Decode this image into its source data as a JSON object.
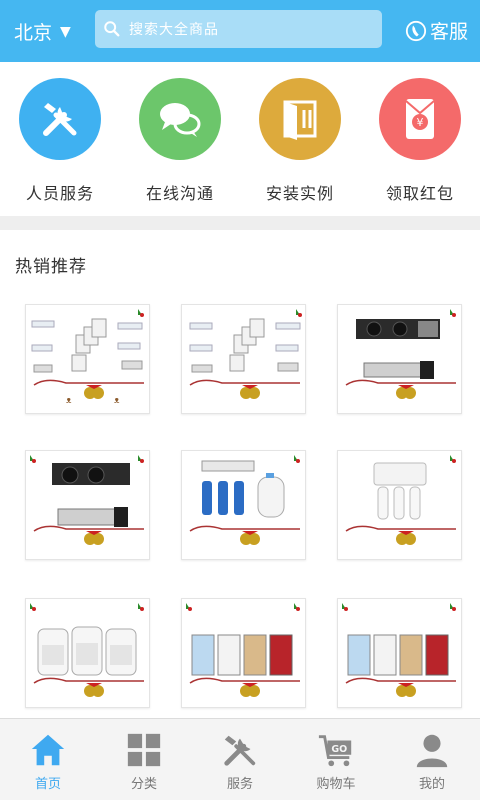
{
  "header": {
    "city": "北京",
    "search_placeholder": "搜索大全商品",
    "service_label": "客服",
    "colors": {
      "bar": "#45b7f1",
      "search_bg": "#a9ddf7"
    }
  },
  "quick_links": [
    {
      "label": "人员服务",
      "icon": "tools-icon",
      "color": "#3fb1f1"
    },
    {
      "label": "在线沟通",
      "icon": "chat-bubbles-icon",
      "color": "#6cc66b"
    },
    {
      "label": "安装实例",
      "icon": "door-tools-icon",
      "color": "#ddaa3c"
    },
    {
      "label": "领取红包",
      "icon": "red-envelope-icon",
      "color": "#f46a6a"
    }
  ],
  "section": {
    "title": "热销推荐"
  },
  "products": [
    {
      "image": "multi-split-ac-units-image"
    },
    {
      "image": "multi-split-ac-units-image"
    },
    {
      "image": "ducted-ventilation-unit-image"
    },
    {
      "image": "ducted-ventilation-unit-image"
    },
    {
      "image": "water-purifier-system-image"
    },
    {
      "image": "ro-water-filter-image"
    },
    {
      "image": "air-purifiers-white-image"
    },
    {
      "image": "air-purifiers-color-image"
    },
    {
      "image": "air-purifiers-color-image"
    }
  ],
  "nav": [
    {
      "label": "首页",
      "icon": "home-icon",
      "active": true
    },
    {
      "label": "分类",
      "icon": "grid-icon",
      "active": false
    },
    {
      "label": "服务",
      "icon": "tools-icon",
      "active": false
    },
    {
      "label": "购物车",
      "icon": "cart-go-icon",
      "active": false
    },
    {
      "label": "我的",
      "icon": "user-icon",
      "active": false
    }
  ]
}
